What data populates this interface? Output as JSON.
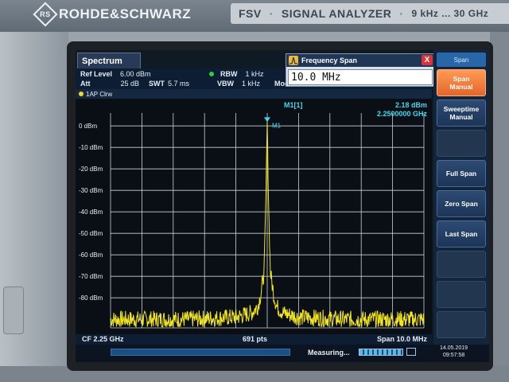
{
  "device": {
    "brand": "ROHDE&SCHWARZ",
    "model": "FSV",
    "description": "SIGNAL ANALYZER",
    "range": "9 kHz ... 30 GHz"
  },
  "header": {
    "tab_label": "Spectrum",
    "ref_level_label": "Ref Level",
    "ref_level_value": "6.00 dBm",
    "att_label": "Att",
    "att_value": "25 dB",
    "swt_label": "SWT",
    "swt_value": "5.7 ms",
    "rbw_label": "RBW",
    "rbw_value": "1 kHz",
    "vbw_label": "VBW",
    "vbw_value": "1 kHz",
    "mode_label": "Mode"
  },
  "dialog": {
    "title": "Frequency Span",
    "value": "10.0 MHz",
    "close_label": "X"
  },
  "trace": {
    "label": "1AP Clrw",
    "color": "#f2e51b"
  },
  "marker": {
    "name": "M1[1]",
    "short": "M1",
    "level": "2.18 dBm",
    "freq": "2.2500000 GHz",
    "color": "#3fd6f0"
  },
  "status": {
    "cf": "CF 2.25 GHz",
    "points": "691 pts",
    "span": "Span 10.0 MHz"
  },
  "footer": {
    "measuring": "Measuring...",
    "date": "14.05.2019",
    "time": "09:57:58"
  },
  "softkeys": {
    "header": "Span",
    "items": [
      {
        "line1": "Span",
        "line2": "Manual",
        "state": "active"
      },
      {
        "line1": "Sweeptime",
        "line2": "Manual",
        "state": "normal"
      },
      {
        "line1": "",
        "line2": "",
        "state": "empty"
      },
      {
        "line1": "Full Span",
        "line2": "",
        "state": "normal"
      },
      {
        "line1": "Zero Span",
        "line2": "",
        "state": "normal"
      },
      {
        "line1": "Last Span",
        "line2": "",
        "state": "normal"
      },
      {
        "line1": "",
        "line2": "",
        "state": "empty"
      },
      {
        "line1": "",
        "line2": "",
        "state": "empty"
      },
      {
        "line1": "",
        "line2": "",
        "state": "empty"
      }
    ]
  },
  "chart_data": {
    "type": "line",
    "y_tick_labels": [
      "0 dBm",
      "-10 dBm",
      "-20 dBm",
      "-30 dBm",
      "-40 dBm",
      "-50 dBm",
      "-60 dBm",
      "-70 dBm",
      "-80 dBm"
    ],
    "ylim": [
      -94,
      6
    ],
    "xlim": [
      2.245,
      2.255
    ],
    "x_unit": "GHz",
    "grid": true,
    "series": [
      {
        "x": [
          2.245,
          2.2475,
          2.249,
          2.2495,
          2.2497,
          2.2498,
          2.2499,
          2.24995,
          2.25,
          2.25005,
          2.2501,
          2.2502,
          2.2503,
          2.2505,
          2.251,
          2.2525,
          2.255
        ],
        "y": [
          -90,
          -90,
          -89,
          -87,
          -84,
          -78,
          -68,
          -40,
          2.18,
          -40,
          -68,
          -78,
          -84,
          -87,
          -89,
          -90,
          -90
        ]
      }
    ]
  }
}
